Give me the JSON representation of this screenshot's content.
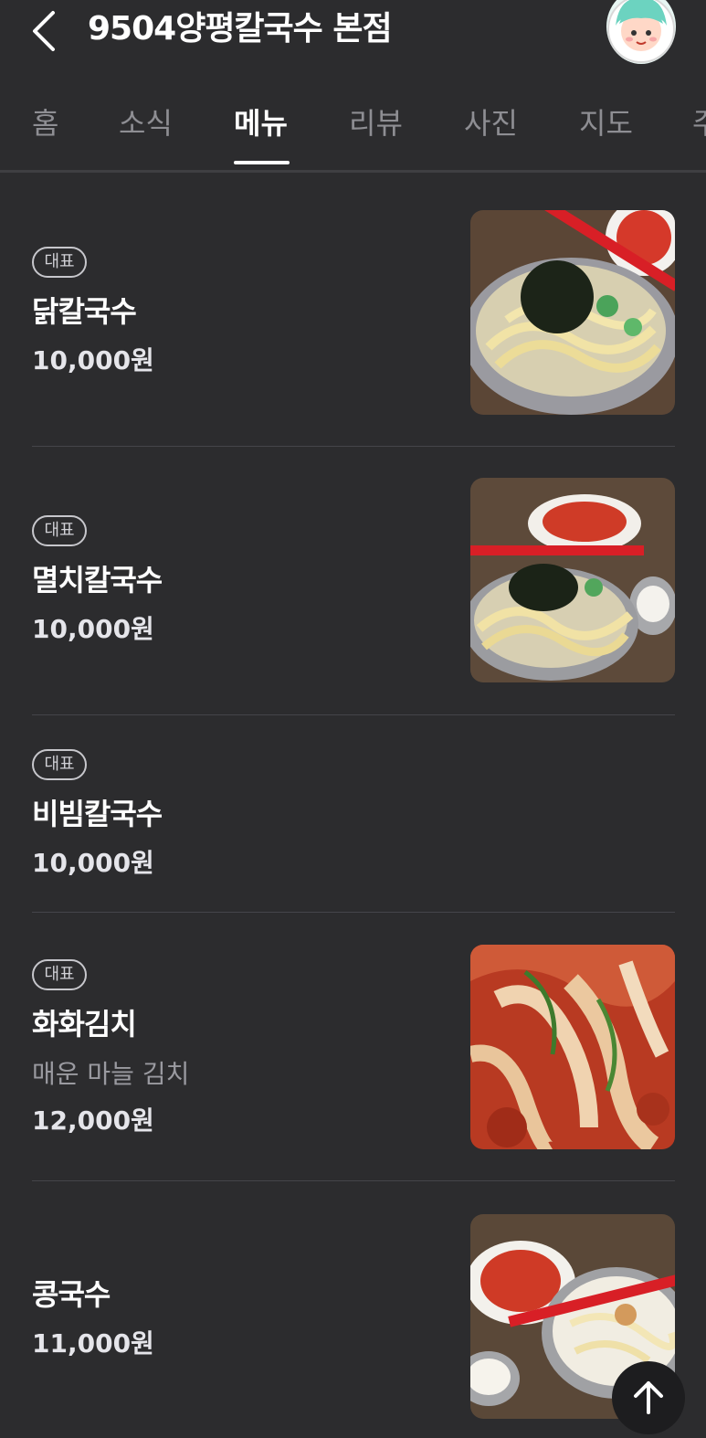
{
  "header": {
    "title": "9504양평칼국수 본점",
    "back_icon": "chevron-left-icon",
    "avatar_icon": "my-avatar-icon"
  },
  "tabs": [
    {
      "label": "홈"
    },
    {
      "label": "소식"
    },
    {
      "label": "메뉴",
      "active": true
    },
    {
      "label": "리뷰"
    },
    {
      "label": "사진"
    },
    {
      "label": "지도"
    },
    {
      "label": "주"
    }
  ],
  "menu": {
    "items": [
      {
        "badge": "대표",
        "name": "닭칼국수",
        "price": "10,000원",
        "image": "noodle-soup-photo"
      },
      {
        "badge": "대표",
        "name": "멸치칼국수",
        "price": "10,000원",
        "image": "anchovy-noodle-photo"
      },
      {
        "badge": "대표",
        "name": "비빔칼국수",
        "price": "10,000원"
      },
      {
        "badge": "대표",
        "name": "화화김치",
        "description": "매운 마늘 김치",
        "price": "12,000원",
        "image": "kimchi-photo"
      },
      {
        "name": "콩국수",
        "price": "11,000원",
        "image": "soybean-noodle-photo"
      }
    ]
  },
  "scroll_top_icon": "arrow-up-icon",
  "colors": {
    "background": "#2c2c2e",
    "text": "#ffffff",
    "muted": "#8e8e93"
  }
}
